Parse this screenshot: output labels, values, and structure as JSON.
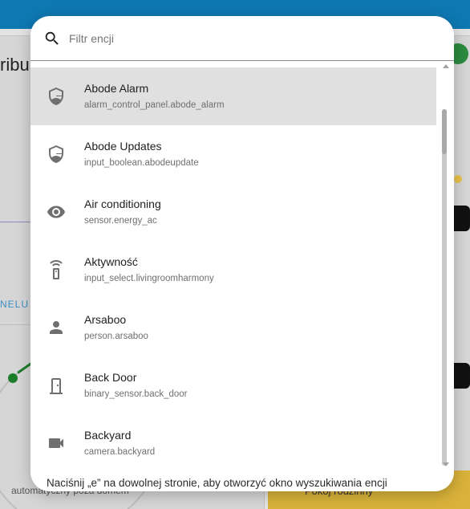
{
  "background": {
    "title_fragment": "ribu",
    "tab_fragment": "NELU I",
    "hint_left": "automatyczny   poza domem",
    "yellow_card_label": "Pokój rodzinny"
  },
  "search": {
    "placeholder": "Filtr encji",
    "value": ""
  },
  "entities": [
    {
      "name": "Abode Alarm",
      "entity_id": "alarm_control_panel.abode_alarm",
      "icon": "shield-half-icon",
      "selected": true
    },
    {
      "name": "Abode Updates",
      "entity_id": "input_boolean.abodeupdate",
      "icon": "shield-half-icon",
      "selected": false
    },
    {
      "name": "Air conditioning",
      "entity_id": "sensor.energy_ac",
      "icon": "eye-icon",
      "selected": false
    },
    {
      "name": "Aktywność",
      "entity_id": "input_select.livingroomharmony",
      "icon": "remote-icon",
      "selected": false
    },
    {
      "name": "Arsaboo",
      "entity_id": "person.arsaboo",
      "icon": "person-icon",
      "selected": false
    },
    {
      "name": "Back Door",
      "entity_id": "binary_sensor.back_door",
      "icon": "door-icon",
      "selected": false
    },
    {
      "name": "Backyard",
      "entity_id": "camera.backyard",
      "icon": "video-camera-icon",
      "selected": false
    }
  ],
  "footer_hint": "Naciśnij „e” na dowolnej stronie, aby otworzyć okno wyszukiwania encji",
  "colors": {
    "topbar": "#0e78b2",
    "selected_row": "#e0e0e0",
    "icon": "#6f6f6f"
  }
}
